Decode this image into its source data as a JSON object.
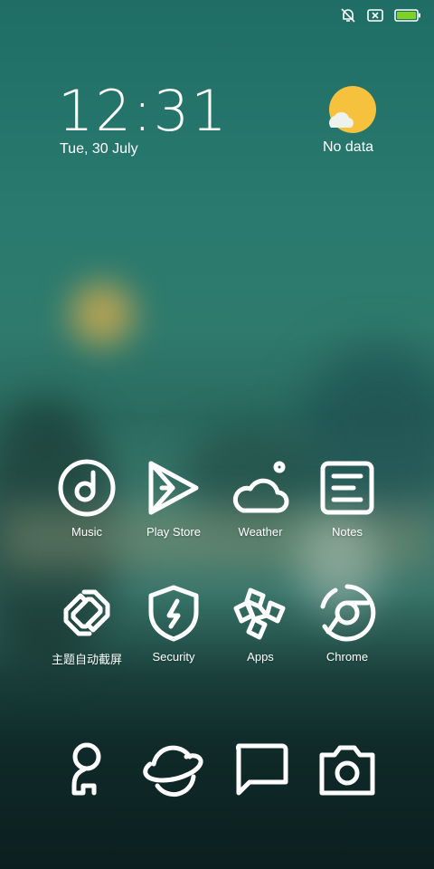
{
  "status_bar": {
    "icons": [
      "notifications-off-icon",
      "no-sim-icon",
      "battery-icon"
    ],
    "battery_color": "#7ed321"
  },
  "lockscreen_widget": {
    "time": "12:31",
    "date": "Tue, 30 July",
    "weather": {
      "icon": "sun-cloud-icon",
      "text": "No data",
      "sun_color": "#f6c23e"
    }
  },
  "apps_row1": [
    {
      "label": "Music",
      "icon": "music-icon"
    },
    {
      "label": "Play Store",
      "icon": "play-store-icon"
    },
    {
      "label": "Weather",
      "icon": "weather-icon"
    },
    {
      "label": "Notes",
      "icon": "notes-icon"
    }
  ],
  "apps_row2": [
    {
      "label": "主题自动截屏",
      "icon": "link-icon"
    },
    {
      "label": "Security",
      "icon": "shield-icon"
    },
    {
      "label": "Apps",
      "icon": "apps-icon"
    },
    {
      "label": "Chrome",
      "icon": "chrome-icon"
    }
  ],
  "dock": [
    {
      "icon": "contacts-icon"
    },
    {
      "icon": "browser-planet-icon"
    },
    {
      "icon": "messages-icon"
    },
    {
      "icon": "camera-icon"
    }
  ]
}
